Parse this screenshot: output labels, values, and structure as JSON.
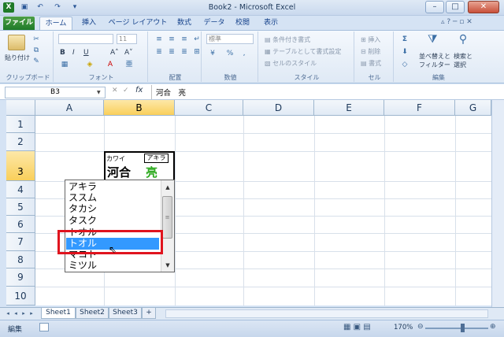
{
  "window": {
    "title": "Book2 - Microsoft Excel",
    "controls": {
      "minimize": "–",
      "maximize": "□",
      "close": "✕"
    }
  },
  "qat": {
    "excel_icon": "X",
    "save_icon": "💾",
    "undo": "↶",
    "redo": "↷"
  },
  "tabs": {
    "file": "ファイル",
    "home": "ホーム",
    "insert": "挿入",
    "page_layout": "ページ レイアウト",
    "formulas": "数式",
    "data": "データ",
    "review": "校閲",
    "view": "表示"
  },
  "ribbon": {
    "clipboard": {
      "label": "クリップボード",
      "paste": "貼り付け"
    },
    "font": {
      "label": "フォント",
      "size": "11"
    },
    "alignment": {
      "label": "配置"
    },
    "number": {
      "label": "数値",
      "format": "標準"
    },
    "styles": {
      "label": "スタイル",
      "conditional": "条件付き書式",
      "table": "テーブルとして書式設定",
      "cell_style": "セルのスタイル"
    },
    "cells": {
      "label": "セル",
      "insert": "挿入",
      "delete": "削除",
      "format": "書式"
    },
    "editing": {
      "label": "編集",
      "sort_line1": "並べ替えと",
      "sort_line2": "フィルター",
      "find_line1": "検索と",
      "find_line2": "選択"
    }
  },
  "formula_bar": {
    "name_box": "B3",
    "fx": "fx",
    "content": "河合　亮"
  },
  "columns": [
    "A",
    "B",
    "C",
    "D",
    "E",
    "F"
  ],
  "rows": [
    "1",
    "2",
    "3",
    "4",
    "5",
    "6",
    "7",
    "8",
    "9",
    "10"
  ],
  "cell_b3": {
    "furigana_last": "カワイ",
    "furigana_first": "アキラ",
    "kanji_last": "河合",
    "kanji_first": "亮"
  },
  "dropdown": {
    "items": [
      "アキラ",
      "ススム",
      "タカシ",
      "タスク",
      "トオル",
      "トオル",
      "マコト",
      "ミツル"
    ],
    "selected_index": 5
  },
  "sheet_tabs": [
    "Sheet1",
    "Sheet2",
    "Sheet3"
  ],
  "status": {
    "mode": "編集",
    "zoom": "170%"
  }
}
